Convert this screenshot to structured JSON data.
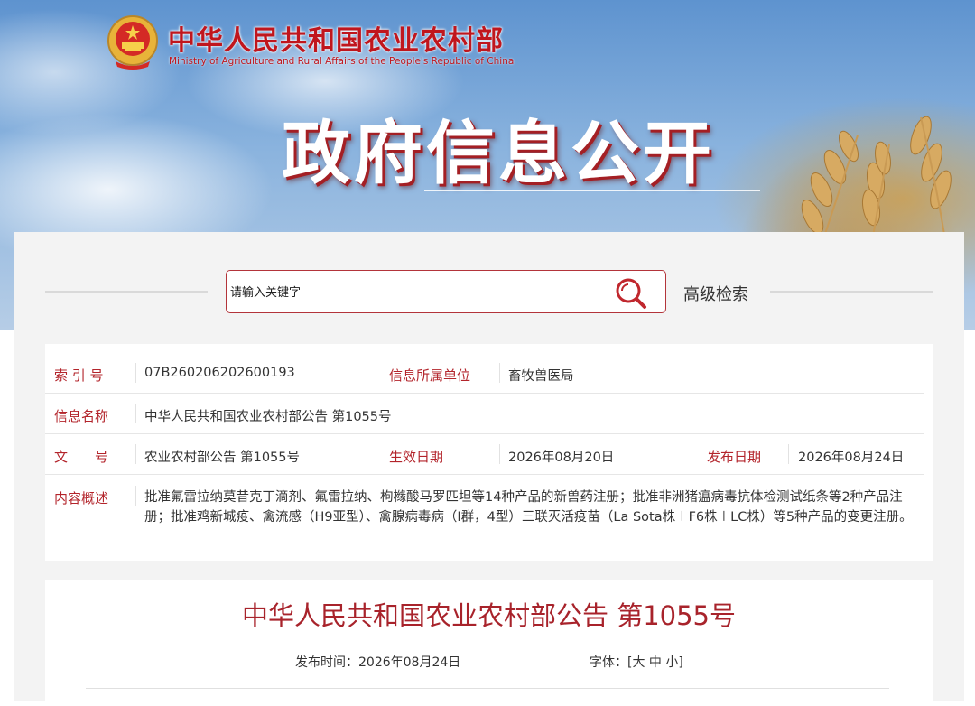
{
  "header": {
    "ministry_cn": "中华人民共和国农业农村部",
    "ministry_en": "Ministry of Agriculture and Rural Affairs of the People's Republic of China",
    "section_title": "政府信息公开",
    "emblem_icon": "national-emblem-icon"
  },
  "search": {
    "placeholder": "请输入关键字",
    "advanced_label": "高级检索",
    "icon": "search-icon"
  },
  "info": {
    "index_label": "索 引 号",
    "index_value": "07B260206202600193",
    "unit_label": "信息所属单位",
    "unit_value": "畜牧兽医局",
    "name_label": "信息名称",
    "name_value": "中华人民共和国农业农村部公告 第1055号",
    "doc_label": "文　　号",
    "doc_value": "农业农村部公告 第1055号",
    "effective_label": "生效日期",
    "effective_value": "2026年08月20日",
    "publish_label": "发布日期",
    "publish_value": "2026年08月24日",
    "summary_label": "内容概述",
    "summary_value": "批准氟雷拉纳莫昔克丁滴剂、氟雷拉纳、枸橼酸马罗匹坦等14种产品的新兽药注册；批准非洲猪瘟病毒抗体检测试纸条等2种产品注册；批准鸡新城疫、禽流感（H9亚型）、禽腺病毒病（I群，4型）三联灭活疫苗（La Sota株＋F6株＋LC株）等5种产品的变更注册。"
  },
  "article": {
    "title": "中华人民共和国农业农村部公告 第1055号",
    "publish_time_label": "发布时间：",
    "publish_time_value": "2026年08月24日",
    "font_label": "字体：",
    "font_open": "[",
    "font_large": "大",
    "font_medium": "中",
    "font_small": "小",
    "font_close": "]"
  },
  "colors": {
    "accent_red": "#b3242b",
    "title_red": "#a8232b",
    "banner_blue": "#5e93cf"
  }
}
